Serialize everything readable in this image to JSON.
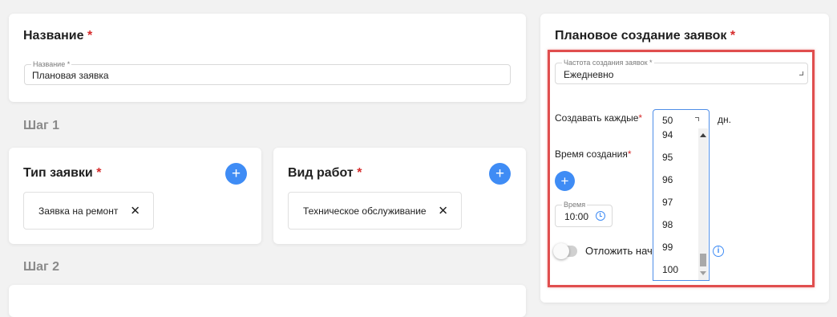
{
  "name_card": {
    "title": "Название",
    "required_mark": "*",
    "field_label": "Название *",
    "field_value": "Плановая заявка"
  },
  "step1_label": "Шаг 1",
  "step2_label": "Шаг 2",
  "request_type_card": {
    "title": "Тип заявки",
    "required_mark": "*",
    "add_label": "+",
    "chip_text": "Заявка на ремонт",
    "chip_close": "✕"
  },
  "work_type_card": {
    "title": "Вид работ",
    "required_mark": "*",
    "add_label": "+",
    "chip_text": "Техническое обслуживание",
    "chip_close": "✕"
  },
  "planning_card": {
    "title": "Плановое создание заявок",
    "required_mark": "*",
    "frequency_label": "Частота создания заявок *",
    "frequency_value": "Ежедневно",
    "create_every_label": "Создавать каждые",
    "create_every_required": "*",
    "create_every_value": "50",
    "create_every_unit": "дн.",
    "create_time_label": "Время создания",
    "create_time_required": "*",
    "add_label": "+",
    "time_field_label": "Время",
    "time_value": "10:00",
    "postpone_label": "Отложить нач",
    "info_icon": "i",
    "dropdown_options": [
      "94",
      "95",
      "96",
      "97",
      "98",
      "99",
      "100"
    ]
  },
  "colors": {
    "accent": "#3f8cf5",
    "required": "#d62b2b",
    "highlight_frame": "#e04e4e"
  }
}
